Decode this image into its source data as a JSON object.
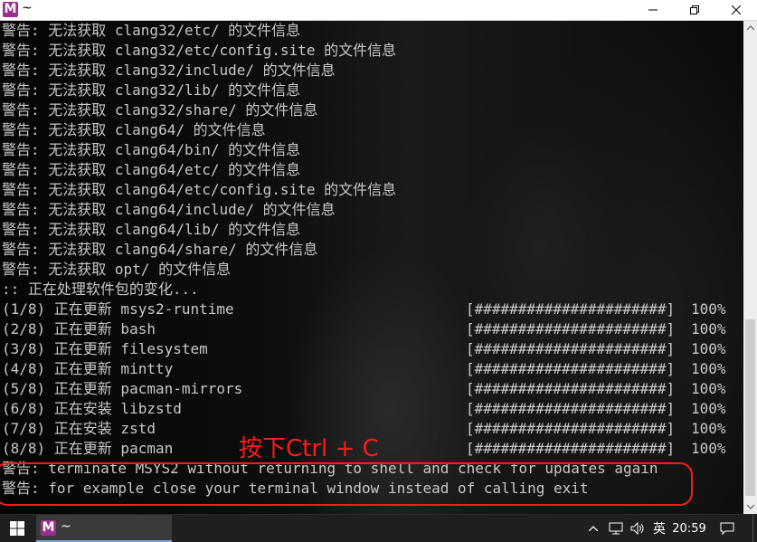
{
  "window": {
    "title": "~",
    "app_icon_letter": "M",
    "app_icon_color": "#9b2d8f"
  },
  "terminal": {
    "lines": [
      {
        "text": "警告: 无法获取 clang32/etc/ 的文件信息"
      },
      {
        "text": "警告: 无法获取 clang32/etc/config.site 的文件信息"
      },
      {
        "text": "警告: 无法获取 clang32/include/ 的文件信息"
      },
      {
        "text": "警告: 无法获取 clang32/lib/ 的文件信息"
      },
      {
        "text": "警告: 无法获取 clang32/share/ 的文件信息"
      },
      {
        "text": "警告: 无法获取 clang64/ 的文件信息"
      },
      {
        "text": "警告: 无法获取 clang64/bin/ 的文件信息"
      },
      {
        "text": "警告: 无法获取 clang64/etc/ 的文件信息"
      },
      {
        "text": "警告: 无法获取 clang64/etc/config.site 的文件信息"
      },
      {
        "text": "警告: 无法获取 clang64/include/ 的文件信息"
      },
      {
        "text": "警告: 无法获取 clang64/lib/ 的文件信息"
      },
      {
        "text": "警告: 无法获取 clang64/share/ 的文件信息"
      },
      {
        "text": "警告: 无法获取 opt/ 的文件信息"
      },
      {
        "text": ":: 正在处理软件包的变化..."
      },
      {
        "text": "(1/8) 正在更新 msys2-runtime",
        "bar": "[######################]",
        "pct": "100%"
      },
      {
        "text": "(2/8) 正在更新 bash",
        "bar": "[######################]",
        "pct": "100%"
      },
      {
        "text": "(3/8) 正在更新 filesystem",
        "bar": "[######################]",
        "pct": "100%"
      },
      {
        "text": "(4/8) 正在更新 mintty",
        "bar": "[######################]",
        "pct": "100%"
      },
      {
        "text": "(5/8) 正在更新 pacman-mirrors",
        "bar": "[######################]",
        "pct": "100%"
      },
      {
        "text": "(6/8) 正在安装 libzstd",
        "bar": "[######################]",
        "pct": "100%"
      },
      {
        "text": "(7/8) 正在安装 zstd",
        "bar": "[######################]",
        "pct": "100%"
      },
      {
        "text": "(8/8) 正在更新 pacman",
        "bar": "[######################]",
        "pct": "100%"
      },
      {
        "text": "警告: terminate MSYS2 without returning to shell and check for updates again"
      },
      {
        "text": "警告: for example close your terminal window instead of calling exit"
      }
    ]
  },
  "annotation": {
    "text": "按下Ctrl + C",
    "color": "#ff1a1a"
  },
  "taskbar": {
    "app_title": "~",
    "ime_label": "英",
    "clock": "20:59"
  },
  "colors": {
    "terminal_text": "#c8c8c8",
    "taskbar_bg": "#1f1f1f",
    "accent": "#7aa7d8"
  }
}
